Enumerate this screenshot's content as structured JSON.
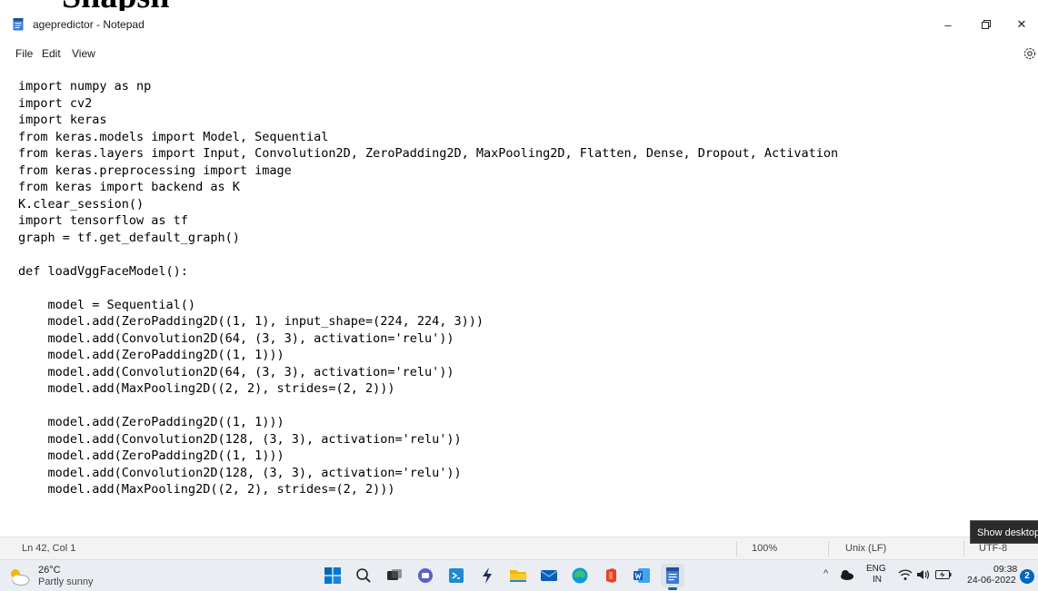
{
  "top_fragment_text": "Snapsh",
  "window": {
    "title": "agepredictor - Notepad",
    "controls": [
      "–",
      "▢",
      "✕"
    ]
  },
  "menu": {
    "file": "File",
    "edit": "Edit",
    "view": "View"
  },
  "editor": {
    "content": "import numpy as np\nimport cv2\nimport keras\nfrom keras.models import Model, Sequential\nfrom keras.layers import Input, Convolution2D, ZeroPadding2D, MaxPooling2D, Flatten, Dense, Dropout, Activation\nfrom keras.preprocessing import image\nfrom keras import backend as K\nK.clear_session()\nimport tensorflow as tf\ngraph = tf.get_default_graph()\n\ndef loadVggFaceModel():\n\n    model = Sequential()\n    model.add(ZeroPadding2D((1, 1), input_shape=(224, 224, 3)))\n    model.add(Convolution2D(64, (3, 3), activation='relu'))\n    model.add(ZeroPadding2D((1, 1)))\n    model.add(Convolution2D(64, (3, 3), activation='relu'))\n    model.add(MaxPooling2D((2, 2), strides=(2, 2)))\n\n    model.add(ZeroPadding2D((1, 1)))\n    model.add(Convolution2D(128, (3, 3), activation='relu'))\n    model.add(ZeroPadding2D((1, 1)))\n    model.add(Convolution2D(128, (3, 3), activation='relu'))\n    model.add(MaxPooling2D((2, 2), strides=(2, 2)))"
  },
  "status": {
    "position": "Ln 42, Col 1",
    "zoom": "100%",
    "line_ending": "Unix (LF)",
    "encoding": "UTF-8"
  },
  "tooltip": "Show desktop",
  "taskbar": {
    "weather_temp": "26°C",
    "weather_condition": "Partly sunny",
    "lang_line1": "ENG",
    "lang_line2": "IN",
    "time": "09:38",
    "date": "24-06-2022",
    "notification_count": "2",
    "apps": [
      "start-icon",
      "search-icon",
      "task-view-icon",
      "teams-chat-icon",
      "vscode-icon",
      "power-automate-icon",
      "file-explorer-icon",
      "mail-icon",
      "edge-icon",
      "office-icon",
      "word-icon",
      "notepad-icon"
    ]
  },
  "colors": {
    "accent": "#0067c0",
    "taskbar_bg": "#eaeef3",
    "statusbar_bg": "#f3f3f3"
  }
}
